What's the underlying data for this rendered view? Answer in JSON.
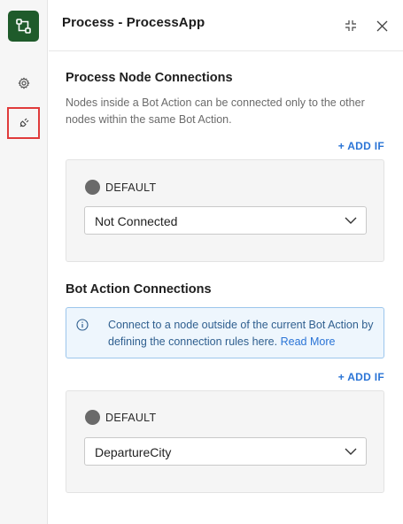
{
  "panel": {
    "title": "Process - ProcessApp"
  },
  "sidebar": {
    "items": [
      {
        "icon": "gear-icon",
        "active": false
      },
      {
        "icon": "plug-icon",
        "active": true
      }
    ]
  },
  "process_node_connections": {
    "heading": "Process Node Connections",
    "description": "Nodes inside a Bot Action can be connected only to the other nodes within the same Bot Action.",
    "add_if_label": "+ ADD IF",
    "default_label": "DEFAULT",
    "selected_value": "Not Connected"
  },
  "bot_action_connections": {
    "heading": "Bot Action Connections",
    "info_text": "Connect to a node outside of the current Bot Action by defining the connection rules here.",
    "info_link": "Read More",
    "add_if_label": "+ ADD IF",
    "default_label": "DEFAULT",
    "selected_value": "DepartureCity"
  },
  "colors": {
    "brand": "#1f5b2b",
    "link": "#2a74d6",
    "highlight": "#e03b3b",
    "info_bg": "#eef6fd"
  }
}
